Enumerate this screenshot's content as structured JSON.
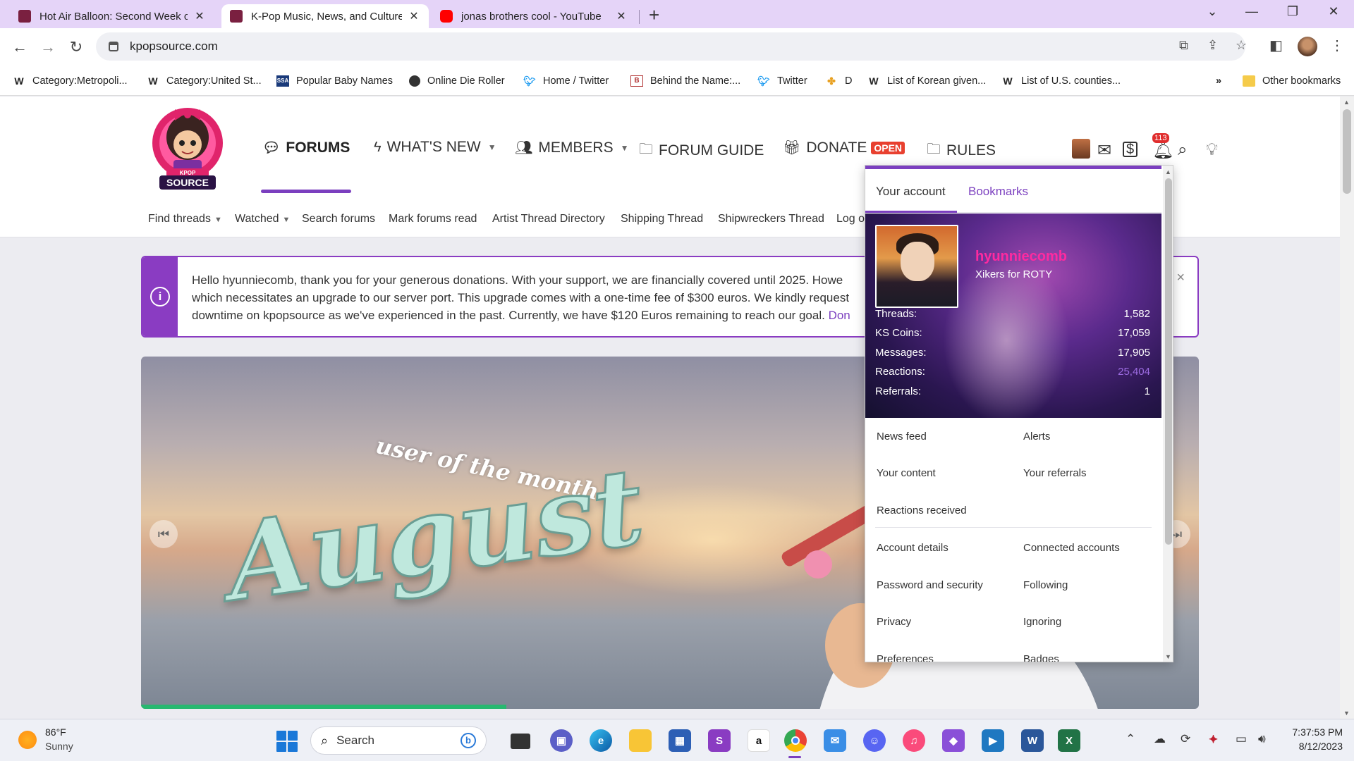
{
  "browser": {
    "tabs": [
      {
        "title": "Hot Air Balloon: Second Week of",
        "active": false
      },
      {
        "title": "K-Pop Music, News, and Culture",
        "active": true
      },
      {
        "title": "jonas brothers cool - YouTube",
        "active": false
      }
    ],
    "url": "kpopsource.com",
    "bookmarks": [
      {
        "label": "Category:Metropoli...",
        "icon": "wikipedia-icon"
      },
      {
        "label": "Category:United St...",
        "icon": "wikipedia-icon"
      },
      {
        "label": "Popular Baby Names",
        "icon": "ssa-icon"
      },
      {
        "label": "Online Die Roller",
        "icon": "globe-icon"
      },
      {
        "label": "Home / Twitter",
        "icon": "twitter-icon"
      },
      {
        "label": "Behind the Name:...",
        "icon": "behindthename-icon"
      },
      {
        "label": "Twitter",
        "icon": "twitter-icon"
      },
      {
        "label": "D",
        "icon": "pinwheel-icon"
      },
      {
        "label": "List of Korean given...",
        "icon": "wikipedia-icon"
      },
      {
        "label": "List of U.S. counties...",
        "icon": "wikipedia-icon"
      }
    ],
    "other_bookmarks": "Other bookmarks",
    "overflow": "»"
  },
  "site": {
    "logo_text": [
      "KPOP",
      "SOURCE"
    ],
    "nav": {
      "forums": "FORUMS",
      "whats_new": "WHAT'S NEW",
      "members": "MEMBERS",
      "forum_guide": "FORUM GUIDE",
      "donate": "DONATE",
      "donate_badge": "OPEN",
      "rules": "RULES"
    },
    "alert_count": "113",
    "subnav": [
      "Find threads",
      "Watched",
      "Search forums",
      "Mark forums read",
      "Artist Thread Directory",
      "Shipping Thread",
      "Shipwreckers Thread",
      "Log o"
    ],
    "notice": {
      "line1": "Hello hyunniecomb, thank you for your generous donations. With your support, we are financially covered until 2025. Howe",
      "line2": "which necessitates an upgrade to our server port. This upgrade comes with a one-time fee of $300 euros. We kindly request",
      "line3": "downtime on kpopsource as we've experienced in the past. Currently, we have $120 Euros remaining to reach our goal.",
      "link": "Don",
      "close": "×"
    },
    "banner": {
      "subtitle": "user of the month",
      "title": "August",
      "slide_progress": 0.345
    }
  },
  "account_popup": {
    "tabs": {
      "account": "Your account",
      "bookmarks": "Bookmarks"
    },
    "username": "hyunniecomb",
    "user_title": "Xikers for ROTY",
    "stats": [
      {
        "label": "Threads:",
        "value": "1,582"
      },
      {
        "label": "KS Coins:",
        "value": "17,059"
      },
      {
        "label": "Messages:",
        "value": "17,905"
      },
      {
        "label": "Reactions:",
        "value": "25,404"
      },
      {
        "label": "Referrals:",
        "value": "1"
      }
    ],
    "menu": {
      "news_feed": "News feed",
      "alerts": "Alerts",
      "your_content": "Your content",
      "your_referrals": "Your referrals",
      "reactions_received": "Reactions received",
      "account_details": "Account details",
      "connected_accounts": "Connected accounts",
      "password_security": "Password and security",
      "following": "Following",
      "privacy": "Privacy",
      "ignoring": "Ignoring",
      "preferences": "Preferences",
      "badges": "Badges"
    }
  },
  "taskbar": {
    "weather_temp": "86°F",
    "weather_desc": "Sunny",
    "search_label": "Search",
    "time": "7:37:53 PM",
    "date": "8/12/2023"
  },
  "colors": {
    "accent": "#7b3fbf",
    "tabstrip": "#e5d4f8",
    "badge_red": "#e8402f",
    "username_pink": "#ff2aa0"
  }
}
